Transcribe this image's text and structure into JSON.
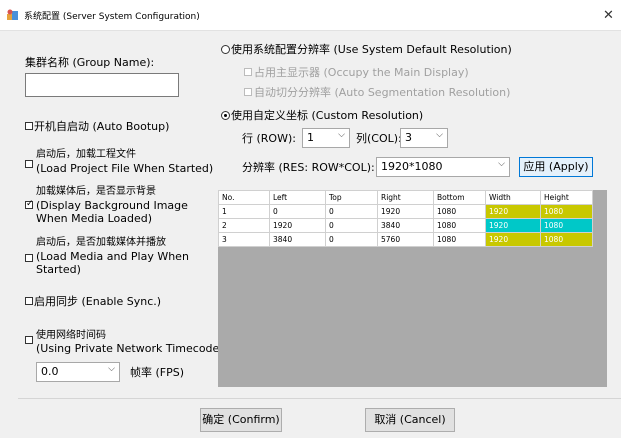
{
  "window": {
    "title": "系统配置 (Server System Configuration)"
  },
  "left": {
    "group_label": "集群名称 (Group Name):",
    "group_value": "",
    "auto_bootup": "开机自启动 (Auto Bootup)",
    "load_project_1": "启动后，加载工程文件",
    "load_project_2": "(Load Project File When Started)",
    "bg_image_1": "加载媒体后，是否显示背景",
    "bg_image_2": "(Display Background Image",
    "bg_image_3": "When Media Loaded)",
    "load_play_1": "启动后，是否加载媒体并播放",
    "load_play_2": "(Load Media and Play When",
    "load_play_3": "Started)",
    "sync": "启用同步 (Enable Sync.)",
    "timecode_1": "使用网络时间码",
    "timecode_2": "(Using Private Network Timecode)",
    "fps_value": "0.0",
    "fps_label": "帧率 (FPS)"
  },
  "right": {
    "system_res": "使用系统配置分辨率 (Use System Default Resolution)",
    "occupy_main": "占用主显示器 (Occupy the Main Display)",
    "auto_seg": "自动切分分辨率 (Auto Segmentation Resolution)",
    "custom_res": "使用自定义坐标 (Custom Resolution)",
    "row_label": "行 (ROW):",
    "row_value": "1",
    "col_label": "列(COL):",
    "col_value": "3",
    "res_label": "分辨率 (RES: ROW*COL):",
    "res_value": "1920*1080",
    "apply": "应用 (Apply)"
  },
  "table": {
    "headers": [
      "No.",
      "Left",
      "Top",
      "Right",
      "Bottom",
      "Width",
      "Height"
    ],
    "rows": [
      [
        "1",
        "0",
        "0",
        "1920",
        "1080",
        "1920",
        "1080"
      ],
      [
        "2",
        "1920",
        "0",
        "3840",
        "1080",
        "1920",
        "1080"
      ],
      [
        "3",
        "3840",
        "0",
        "5760",
        "1080",
        "1920",
        "1080"
      ]
    ]
  },
  "buttons": {
    "confirm": "确定 (Confirm)",
    "cancel": "取消 (Cancel)"
  },
  "colors": {
    "yellow": "#c8c800",
    "teal": "#00c8c8",
    "accent": "#0078d7"
  }
}
